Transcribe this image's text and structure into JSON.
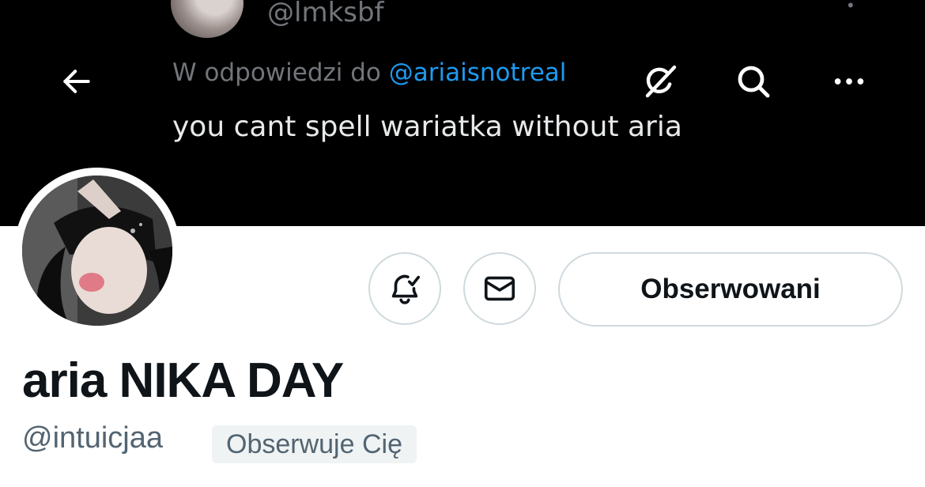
{
  "banner": {
    "tweet_handle": "@lmksbf",
    "reply_prefix": "W odpowiedzi do",
    "reply_mention": "@ariaisnotreal",
    "tweet_text": "you cant spell wariatka without aria"
  },
  "nav": {
    "back_icon": "arrow-left-icon",
    "grok_icon": "grok-icon",
    "search_icon": "search-icon",
    "more_icon": "more-icon"
  },
  "profile": {
    "display_name": "aria NIKA DAY",
    "username": "@intuicjaa",
    "follows_you": "Obserwuje Cię",
    "follow_button_label": "Obserwowani",
    "notifications_icon": "bell-check-icon",
    "message_icon": "mail-icon"
  },
  "colors": {
    "banner_bg": "#000000",
    "mention": "#1d9bf0",
    "text_primary": "#0f1419",
    "text_secondary": "#536471",
    "border": "#cfd9de"
  }
}
